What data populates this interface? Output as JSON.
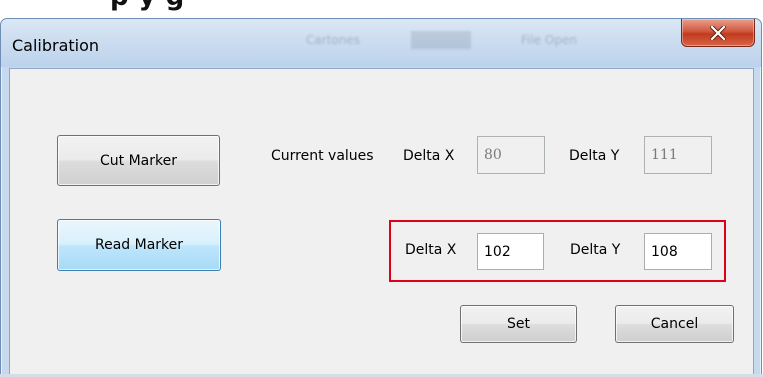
{
  "backdrop": {
    "heading_partial": "p                    y                              g"
  },
  "window": {
    "title": "Calibration",
    "title_ghost": [
      "Cartones",
      "File Open"
    ],
    "close_glyph": "X"
  },
  "buttons": {
    "cut_marker": "Cut Marker",
    "read_marker": "Read Marker",
    "set": "Set",
    "cancel": "Cancel"
  },
  "current": {
    "label": "Current values",
    "delta_x_label": "Delta X",
    "delta_x_value": "80",
    "delta_y_label": "Delta Y",
    "delta_y_value": "111"
  },
  "new_values": {
    "delta_x_label": "Delta X",
    "delta_x_value": "102",
    "delta_y_label": "Delta Y",
    "delta_y_value": "108"
  },
  "colors": {
    "highlight_border": "#e0001a",
    "close_button": "#c9452a",
    "focused_button": "#bee6fd"
  },
  "icons": {
    "close": "close-icon"
  }
}
